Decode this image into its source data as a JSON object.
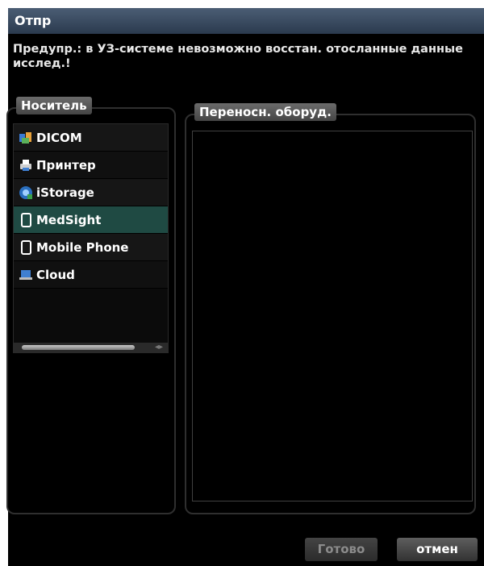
{
  "dialog": {
    "title": "Отпр",
    "warning": "Предупр.: в УЗ-системе невозможно восстан. отосланные данные исслед.!"
  },
  "media": {
    "label": "Носитель",
    "items": [
      {
        "label": "DICOM",
        "icon": "dicom-network-icon"
      },
      {
        "label": "Принтер",
        "icon": "printer-icon"
      },
      {
        "label": "iStorage",
        "icon": "istorage-icon"
      },
      {
        "label": "MedSight",
        "icon": "tablet-icon",
        "selected": true
      },
      {
        "label": "Mobile Phone",
        "icon": "mobile-phone-icon"
      },
      {
        "label": "Cloud",
        "icon": "cloud-laptop-icon"
      }
    ]
  },
  "device": {
    "label": "Переносн. оборуд."
  },
  "buttons": {
    "done": "Готово",
    "cancel": "отмен"
  },
  "colors": {
    "selected_row": "#1f4a43",
    "title_bar": "#2b3a4e"
  }
}
